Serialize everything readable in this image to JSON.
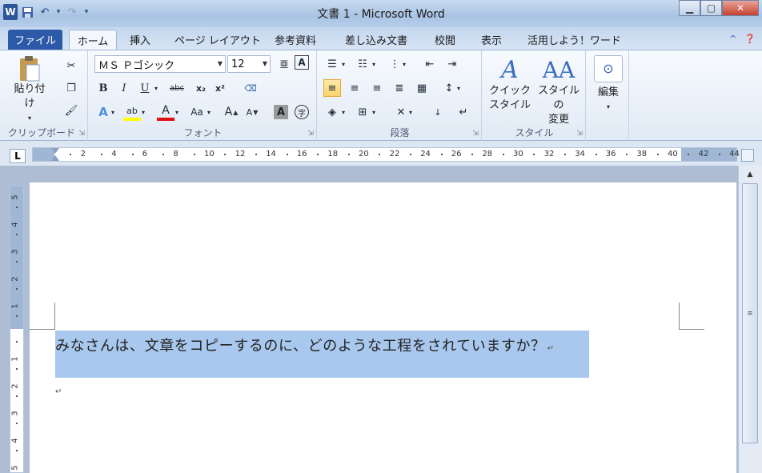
{
  "window": {
    "title": "文書 1 - Microsoft Word",
    "minimize_glyph": "▁",
    "maximize_glyph": "▢",
    "close_glyph": "✕"
  },
  "qat": {
    "app_icon": "W",
    "save_icon": "💾",
    "undo_icon": "↶",
    "redo_icon": "↷",
    "customize_icon": "▾"
  },
  "tabs": [
    {
      "label": "ファイル"
    },
    {
      "label": "ホーム"
    },
    {
      "label": "挿入"
    },
    {
      "label": "ページ レイアウト"
    },
    {
      "label": "参考資料"
    },
    {
      "label": "差し込み文書"
    },
    {
      "label": "校閲"
    },
    {
      "label": "表示"
    },
    {
      "label": "活用しよう！ワード"
    }
  ],
  "ribbon": {
    "clipboard": {
      "label": "クリップボード",
      "paste_label": "貼り付け",
      "paste_arrow": "▾"
    },
    "font": {
      "label": "フォント",
      "font_name": "ＭＳ Ｐゴシック",
      "font_size": "12",
      "bold": "B",
      "italic": "I",
      "underline": "U",
      "strike": "abc",
      "subscript": "x₂",
      "superscript": "x²",
      "case": "Aa",
      "grow": "A",
      "shrink": "A",
      "clear": "A",
      "enclosed": "字"
    },
    "paragraph": {
      "label": "段落"
    },
    "styles": {
      "label": "スタイル",
      "quick_style_line1": "クイック",
      "quick_style_line2": "スタイル",
      "change_style_line1": "スタイルの",
      "change_style_line2": "変更"
    },
    "editing": {
      "label": "編集"
    }
  },
  "ruler": {
    "corner": "L",
    "ticks": [
      "2",
      "4",
      "6",
      "8",
      "10",
      "12",
      "14",
      "16",
      "18",
      "20",
      "22",
      "24",
      "26",
      "28",
      "30",
      "32",
      "34",
      "36",
      "38",
      "40",
      "42",
      "44"
    ]
  },
  "vruler": {
    "ticks_top": [
      "5",
      "4",
      "3",
      "2",
      "1"
    ],
    "ticks_bottom": [
      "1",
      "2",
      "3",
      "4",
      "5"
    ]
  },
  "document": {
    "paragraph1": "みなさんは、文章をコピーするのに、どのような工程をされていますか？",
    "paragraph_mark": "↵"
  },
  "scrollbar": {
    "up": "▲",
    "grip": "≡"
  },
  "colors": {
    "selection": "#a9c8ee",
    "file_tab": "#2c5aa8",
    "highlight": "#ffff00",
    "font_color": "#e01010"
  }
}
